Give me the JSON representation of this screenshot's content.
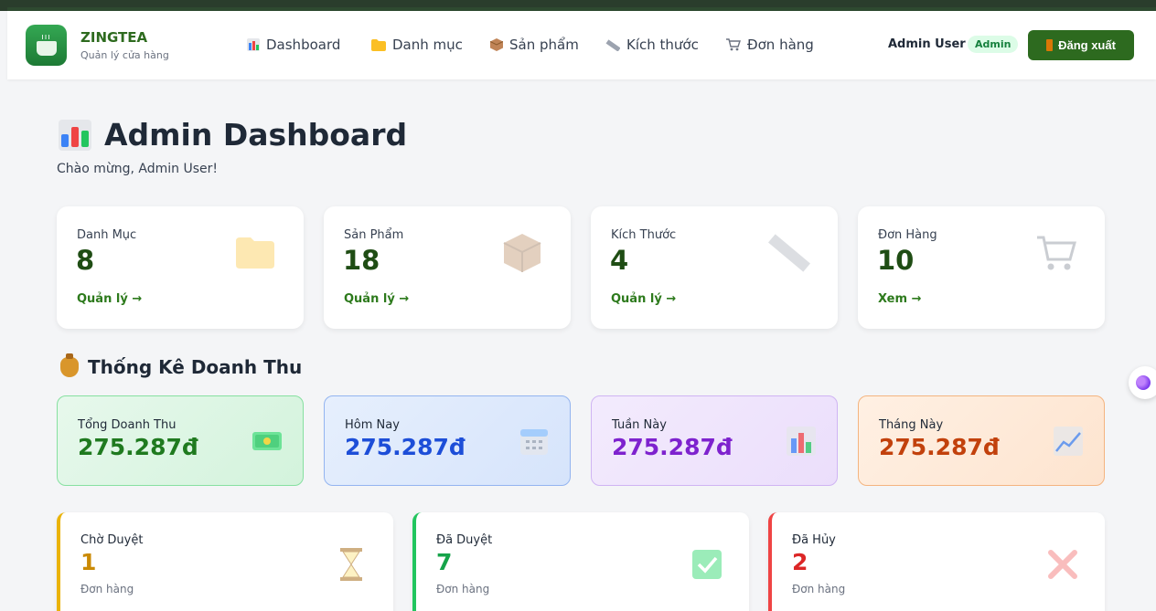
{
  "brand": {
    "name": "ZINGTEA",
    "subtitle": "Quản lý cửa hàng"
  },
  "nav": {
    "items": [
      {
        "label": "Dashboard",
        "icon": "bar-chart-icon"
      },
      {
        "label": "Danh mục",
        "icon": "folder-icon"
      },
      {
        "label": "Sản phẩm",
        "icon": "package-icon"
      },
      {
        "label": "Kích thước",
        "icon": "ruler-icon"
      },
      {
        "label": "Đơn hàng",
        "icon": "cart-icon"
      }
    ],
    "user_name": "Admin User",
    "role": "Admin",
    "logout_label": "Đăng xuất"
  },
  "page": {
    "title": "Admin Dashboard",
    "welcome": "Chào mừng, Admin User!"
  },
  "stats": [
    {
      "label": "Danh Mục",
      "value": "8",
      "link": "Quản lý →",
      "icon": "folder-icon"
    },
    {
      "label": "Sản Phẩm",
      "value": "18",
      "link": "Quản lý →",
      "icon": "package-icon"
    },
    {
      "label": "Kích Thước",
      "value": "4",
      "link": "Quản lý →",
      "icon": "ruler-icon"
    },
    {
      "label": "Đơn Hàng",
      "value": "10",
      "link": "Xem →",
      "icon": "cart-icon"
    }
  ],
  "revenue": {
    "title": "Thống Kê Doanh Thu",
    "cards": [
      {
        "label": "Tổng Doanh Thu",
        "value": "275.287đ",
        "color": "#1f7a1f",
        "icon": "money-icon"
      },
      {
        "label": "Hôm Nay",
        "value": "275.287đ",
        "color": "#1d4ed8",
        "icon": "calendar-icon"
      },
      {
        "label": "Tuần Này",
        "value": "275.287đ",
        "color": "#7e22ce",
        "icon": "bar-chart-icon"
      },
      {
        "label": "Tháng Này",
        "value": "275.287đ",
        "color": "#c2410c",
        "icon": "trend-up-icon"
      }
    ]
  },
  "orders": [
    {
      "label": "Chờ Duyệt",
      "value": "1",
      "unit": "Đơn hàng",
      "color": "#ca8a04",
      "icon": "hourglass-icon"
    },
    {
      "label": "Đã Duyệt",
      "value": "7",
      "unit": "Đơn hàng",
      "color": "#16a34a",
      "icon": "check-icon"
    },
    {
      "label": "Đã Hủy",
      "value": "2",
      "unit": "Đơn hàng",
      "color": "#dc2626",
      "icon": "cross-icon"
    }
  ]
}
